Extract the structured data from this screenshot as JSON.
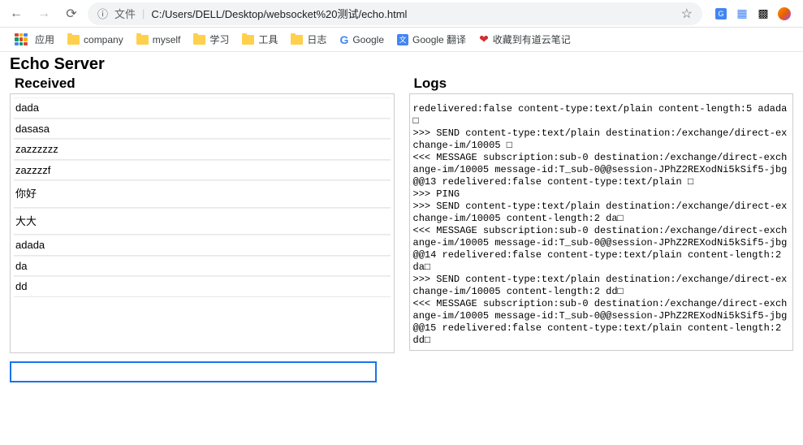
{
  "browser": {
    "addr_prefix": "文件",
    "addr_url": "C:/Users/DELL/Desktop/websocket%20测试/echo.html"
  },
  "bookmarks": {
    "apps": "应用",
    "items": [
      "company",
      "myself",
      "学习",
      "工具",
      "日志"
    ],
    "google": "Google",
    "gtranslate": "Google 翻译",
    "youdao": "收藏到有道云笔记"
  },
  "page": {
    "title": "Echo Server",
    "received_heading": "Received",
    "logs_heading": "Logs",
    "input_value": ""
  },
  "received": [
    "dada",
    "dasasa",
    "zazzzzzz",
    "zazzzzf",
    "你好",
    "大大",
    "adada",
    "da",
    "dd"
  ],
  "logs": "redelivered:false content-type:text/plain content-length:5 adada□\n>>> SEND content-type:text/plain destination:/exchange/direct-exchange-im/10005 □\n<<< MESSAGE subscription:sub-0 destination:/exchange/direct-exchange-im/10005 message-id:T_sub-0@@session-JPhZ2REXodNi5kSif5-jbg@@13 redelivered:false content-type:text/plain □\n>>> PING\n>>> SEND content-type:text/plain destination:/exchange/direct-exchange-im/10005 content-length:2 da□\n<<< MESSAGE subscription:sub-0 destination:/exchange/direct-exchange-im/10005 message-id:T_sub-0@@session-JPhZ2REXodNi5kSif5-jbg@@14 redelivered:false content-type:text/plain content-length:2 da□\n>>> SEND content-type:text/plain destination:/exchange/direct-exchange-im/10005 content-length:2 dd□\n<<< MESSAGE subscription:sub-0 destination:/exchange/direct-exchange-im/10005 message-id:T_sub-0@@session-JPhZ2REXodNi5kSif5-jbg@@15 redelivered:false content-type:text/plain content-length:2 dd□"
}
